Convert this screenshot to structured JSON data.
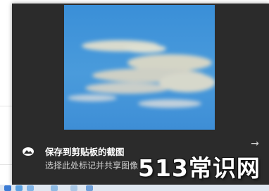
{
  "notification": {
    "title": "保存到剪贴板的截图",
    "subtitle": "选择此处标记并共享图像",
    "app_icon": "snip-icon",
    "expand_icon": "arrow-right-icon"
  },
  "watermark": {
    "text": "513常识网"
  },
  "colors": {
    "toast_bg": "#2b2b2b",
    "sky": "#3c90d6",
    "cloud": "#e8e0c8"
  }
}
